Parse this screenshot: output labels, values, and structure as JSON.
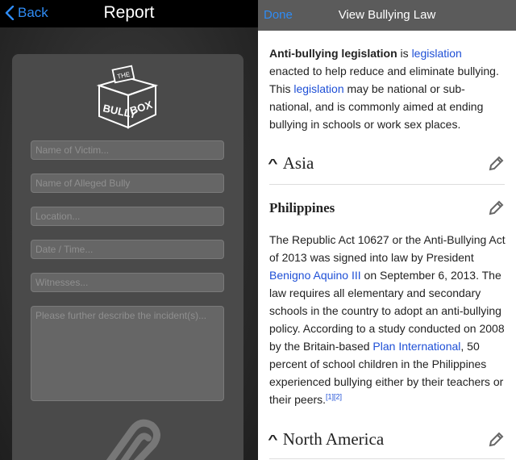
{
  "left": {
    "back_label": "Back",
    "title": "Report",
    "logo_text_top": "THE",
    "logo_text_main": "BULLY BOX",
    "fields": {
      "victim": "Name of Victim...",
      "bully": "Name of Alleged Bully",
      "location": "Location...",
      "datetime": "Date / Time...",
      "witnesses": "Witnesses...",
      "describe": "Please further describe the incident(s)..."
    }
  },
  "right": {
    "done_label": "Done",
    "title": "View Bullying Law",
    "intro": {
      "bold": "Anti-bullying legislation",
      "t1": " is ",
      "link1": "legislation",
      "t2": " enacted to help reduce and eliminate bullying. This ",
      "link2": "legislation",
      "t3": " may be national or sub-national, and is commonly aimed at ending bullying in schools or work sex places."
    },
    "section_asia": "Asia",
    "subsection_philippines": "Philippines",
    "philippines": {
      "t1": "The Republic Act 10627 or the Anti-Bullying Act of 2013 was signed into law by President ",
      "link1": "Benigno Aquino III",
      "t2": " on September 6, 2013. The law requires all elementary and secondary schools in the country to adopt an anti-bullying policy. According to a study conducted on 2008 by the Britain-based ",
      "link2": "Plan International",
      "t3": ", 50 percent of school children in the Philippines experienced bullying either by their teachers or their peers.",
      "ref": "[1][2]"
    },
    "section_north_america": "North America"
  }
}
